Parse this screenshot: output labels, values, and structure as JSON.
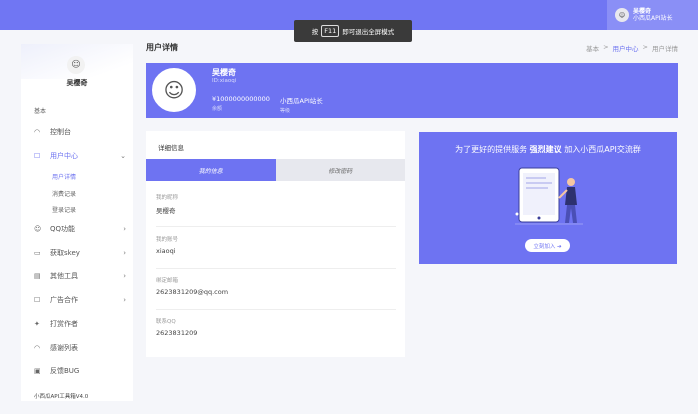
{
  "topbar": {
    "fullscreen_tip": {
      "pre": "按",
      "key": "F11",
      "post": "即可退出全屏模式"
    },
    "user": {
      "name": "吴樱奇",
      "role": "小西瓜API站长",
      "avatar_icon": "user-avatar"
    }
  },
  "sidebar": {
    "name": "吴樱奇",
    "section": "基本",
    "items": [
      {
        "label": "控制台",
        "icon": "dashboard-icon",
        "ic": "◠",
        "chev": ""
      },
      {
        "label": "用户中心",
        "icon": "user-icon",
        "ic": "☐",
        "chev": "⌄"
      },
      {
        "label": "QQ功能",
        "icon": "chat-icon",
        "ic": "☺",
        "chev": "›"
      },
      {
        "label": "获取skey",
        "icon": "monitor-icon",
        "ic": "▭",
        "chev": "›"
      },
      {
        "label": "其他工具",
        "icon": "toolbox-icon",
        "ic": "▤",
        "chev": "›"
      },
      {
        "label": "广告合作",
        "icon": "ad-icon",
        "ic": "☐",
        "chev": "›"
      },
      {
        "label": "打赏作者",
        "icon": "gift-icon",
        "ic": "✦",
        "chev": ""
      },
      {
        "label": "感谢列表",
        "icon": "list-icon",
        "ic": "◠",
        "chev": ""
      },
      {
        "label": "反馈BUG",
        "icon": "bug-icon",
        "ic": "▣",
        "chev": ""
      }
    ],
    "sub_items": [
      "用户详情",
      "消费记录",
      "登录记录"
    ],
    "footer": "小西瓜API工具箱V4.0"
  },
  "header": {
    "title": "用户详情",
    "breadcrumb": [
      "基本",
      "用户中心",
      "用户详情"
    ]
  },
  "profile": {
    "name": "吴樱奇",
    "id": "ID:xiaoqi",
    "balance_value": "¥1000000000000",
    "balance_label": "余额",
    "level_value": "小西瓜API站长",
    "level_label": "等级"
  },
  "detail": {
    "heading": "详细信息",
    "tabs": [
      "我的信息",
      "修改密码"
    ],
    "fields": [
      {
        "label": "我的昵称",
        "value": "吴樱奇"
      },
      {
        "label": "我的账号",
        "value": "xiaoqi"
      },
      {
        "label": "绑定邮箱",
        "value": "2623831209@qq.com"
      },
      {
        "label": "联系QQ",
        "value": "2623831209"
      }
    ]
  },
  "promo": {
    "text_pre": "为了更好的提供服务",
    "text_bold": "强烈建议",
    "text_post": "加入小西瓜API交流群",
    "button": "立刻加入 ➔"
  },
  "colors": {
    "accent": "#6e73f2",
    "topbar": "#7076f3"
  }
}
